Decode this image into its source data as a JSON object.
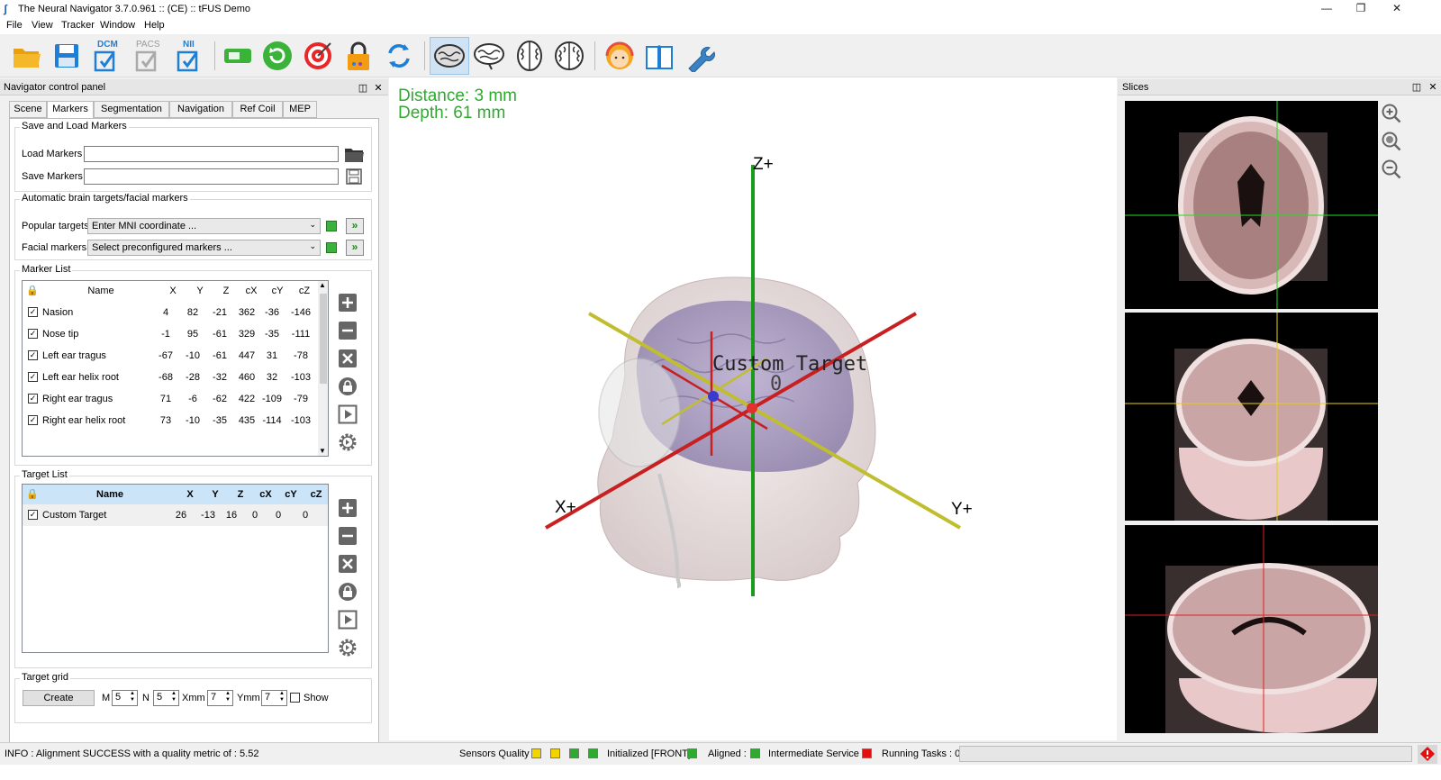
{
  "window": {
    "title": "The Neural Navigator 3.7.0.961 :: (CE) ::  tFUS Demo",
    "icon": "app-logo-icon"
  },
  "menu": [
    "File",
    "View",
    "Tracker",
    "Window",
    "Help"
  ],
  "toolbar": {
    "dcm_label": "DCM",
    "pacs_label": "PACS",
    "nii_label": "NII",
    "buttons": [
      "open-folder-icon",
      "save-disk-icon",
      "dcm-import-icon",
      "pacs-import-icon",
      "nii-import-icon",
      "toggle-on-icon",
      "refresh-green-icon",
      "target-icon",
      "lock-orange-icon",
      "sync-arrows-icon",
      "brain-full-icon",
      "brain-side-icon",
      "brain-top-icon",
      "brain-cortex-icon",
      "support-avatar-icon",
      "manual-book-icon",
      "wrench-icon"
    ]
  },
  "control_panel": {
    "title": "Navigator control panel",
    "tabs": [
      "Scene",
      "Markers",
      "Segmentation",
      "Navigation",
      "Ref Coil",
      "MEP"
    ],
    "active_tab": "Markers",
    "save_load": {
      "title": "Save and Load Markers",
      "load_label": "Load Markers :",
      "save_label": "Save Markers :",
      "load_value": "",
      "save_value": ""
    },
    "auto": {
      "title": "Automatic brain targets/facial markers",
      "popular_label": "Popular targets:",
      "popular_value": "Enter MNI coordinate ...",
      "facial_label": "Facial markers:",
      "facial_value": "Select preconfigured markers ..."
    },
    "marker_list": {
      "title": "Marker List",
      "columns": [
        "Name",
        "X",
        "Y",
        "Z",
        "cX",
        "cY",
        "cZ"
      ],
      "rows": [
        {
          "checked": "✓",
          "name": "Nasion",
          "x": "4",
          "y": "82",
          "z": "-21",
          "cx": "362",
          "cy": "-36",
          "cz": "-146"
        },
        {
          "checked": "✓",
          "name": "Nose tip",
          "x": "-1",
          "y": "95",
          "z": "-61",
          "cx": "329",
          "cy": "-35",
          "cz": "-111"
        },
        {
          "checked": "✓",
          "name": "Left ear tragus",
          "x": "-67",
          "y": "-10",
          "z": "-61",
          "cx": "447",
          "cy": "31",
          "cz": "-78"
        },
        {
          "checked": "✓",
          "name": "Left ear helix root",
          "x": "-68",
          "y": "-28",
          "z": "-32",
          "cx": "460",
          "cy": "32",
          "cz": "-103"
        },
        {
          "checked": "✓",
          "name": "Right ear tragus",
          "x": "71",
          "y": "-6",
          "z": "-62",
          "cx": "422",
          "cy": "-109",
          "cz": "-79"
        },
        {
          "checked": "✓",
          "name": "Right ear helix root",
          "x": "73",
          "y": "-10",
          "z": "-35",
          "cx": "435",
          "cy": "-114",
          "cz": "-103"
        }
      ]
    },
    "target_list": {
      "title": "Target List",
      "columns": [
        "Name",
        "X",
        "Y",
        "Z",
        "cX",
        "cY",
        "cZ"
      ],
      "rows": [
        {
          "checked": "✓",
          "name": "Custom Target",
          "x": "26",
          "y": "-13",
          "z": "16",
          "cx": "0",
          "cy": "0",
          "cz": "0"
        }
      ]
    },
    "target_grid": {
      "title": "Target grid",
      "create_label": "Create",
      "m_label": "M",
      "m_value": "5",
      "n_label": "N",
      "n_value": "5",
      "xmm_label": "Xmm",
      "xmm_value": "7",
      "ymm_label": "Ymm",
      "ymm_value": "7",
      "show_label": "Show"
    }
  },
  "view3d": {
    "distance": "Distance:  3 mm",
    "depth": "Depth:  61 mm",
    "axis_z": "Z+",
    "axis_x": "X+",
    "axis_y": "Y+",
    "target_label": "Custom Target",
    "target_index": "0"
  },
  "slices": {
    "title": "Slices"
  },
  "status": {
    "info": "INFO : Alignment SUCCESS with a quality metric of : 5.52",
    "sensors": "Sensors Quality :",
    "initialized": "Initialized [FRONT]",
    "aligned": "Aligned :",
    "intermediate": "Intermediate Service :",
    "running": "Running Tasks : 0"
  },
  "colors": {
    "accent_green": "#2eab2e",
    "header_blue": "#cce4f7",
    "status_red": "#e01010",
    "status_yellow": "#f2d500"
  }
}
